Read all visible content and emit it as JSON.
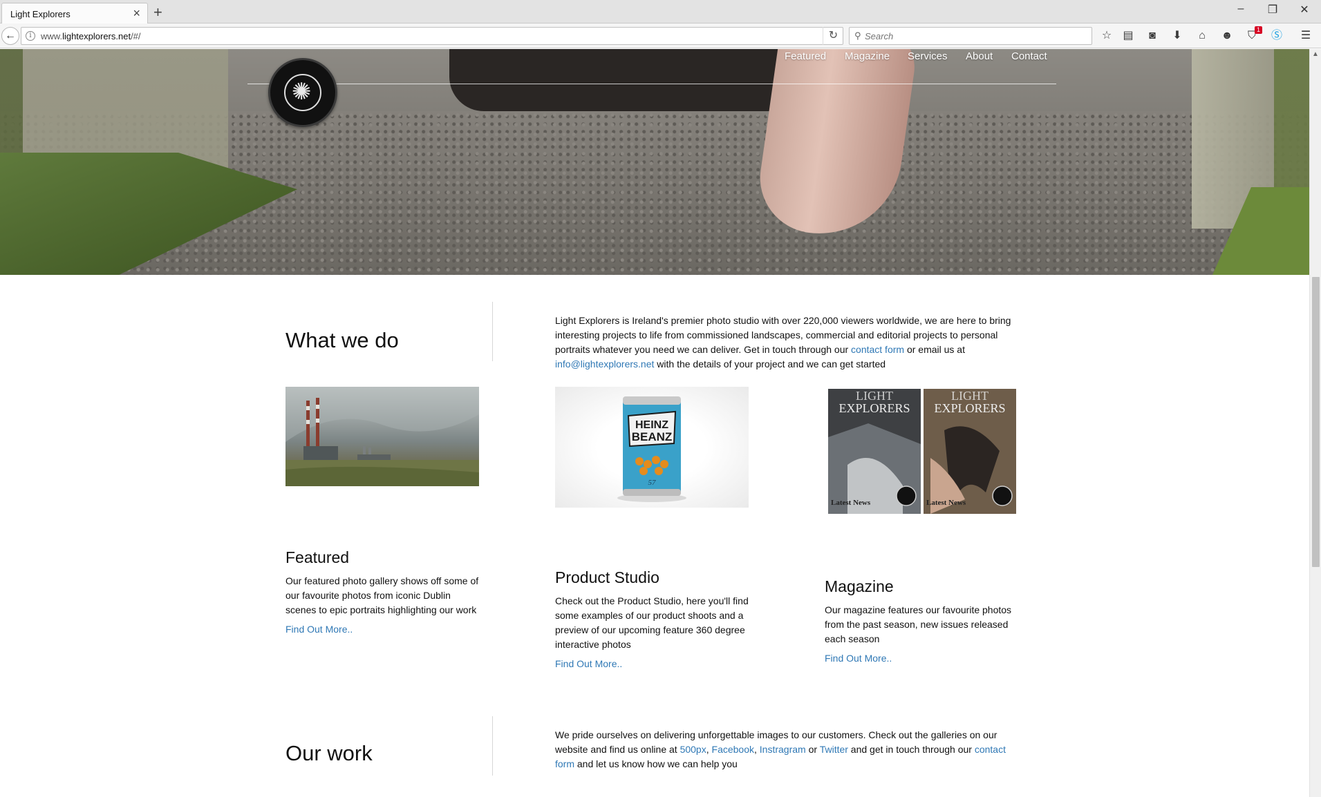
{
  "browser": {
    "tab_title": "Light Explorers",
    "url_prefix": "www.",
    "url_domain": "lightexplorers.net",
    "url_path": "/#/",
    "search_placeholder": "Search",
    "notification_count": "1"
  },
  "site": {
    "nav": [
      "Featured",
      "Magazine",
      "Services",
      "About",
      "Contact"
    ]
  },
  "what_we_do": {
    "heading": "What we do",
    "text_1": "Light Explorers is Ireland's premier photo studio with over 220,000 viewers worldwide, we are here to bring interesting projects to life from commissioned landscapes, commercial and editorial projects to personal portraits whatever you need we can deliver. Get in touch through our ",
    "contact_link": "contact form",
    "text_2": " or email us at ",
    "email_link": "info@lightexplorers.net",
    "text_3": " with the details of your project and we can get started"
  },
  "cards": [
    {
      "title": "Featured",
      "text": "Our featured photo gallery shows off some of our favourite photos from iconic Dublin scenes to epic portraits highlighting our work",
      "link": "Find Out More.."
    },
    {
      "title": "Product Studio",
      "text": "Check out the Product Studio, here you'll find some examples of our product shoots and a preview of our upcoming feature 360 degree interactive photos",
      "link": "Find Out More..",
      "can_brand_top": "HEINZ",
      "can_brand_bottom": "BEANZ",
      "can_number": "57"
    },
    {
      "title": "Magazine",
      "text": "Our magazine features our favourite photos from the past season, new issues released each season",
      "link": "Find Out More..",
      "cover_word_1": "LIGHT",
      "cover_word_2": "EXPLORERS",
      "cover_footer": "Latest News"
    }
  ],
  "our_work": {
    "heading": "Our work",
    "text_1": "We pride ourselves on delivering unforgettable images to our customers. Check out the galleries on our website and find us online at ",
    "link_500px": "500px",
    "sep_1": ", ",
    "link_facebook": "Facebook",
    "sep_2": ", ",
    "link_instagram": "Instragram",
    "sep_3": " or ",
    "link_twitter": "Twitter",
    "text_2": " and get in touch through our ",
    "contact_link": "contact form",
    "text_3": " and let us know how we can help you"
  }
}
